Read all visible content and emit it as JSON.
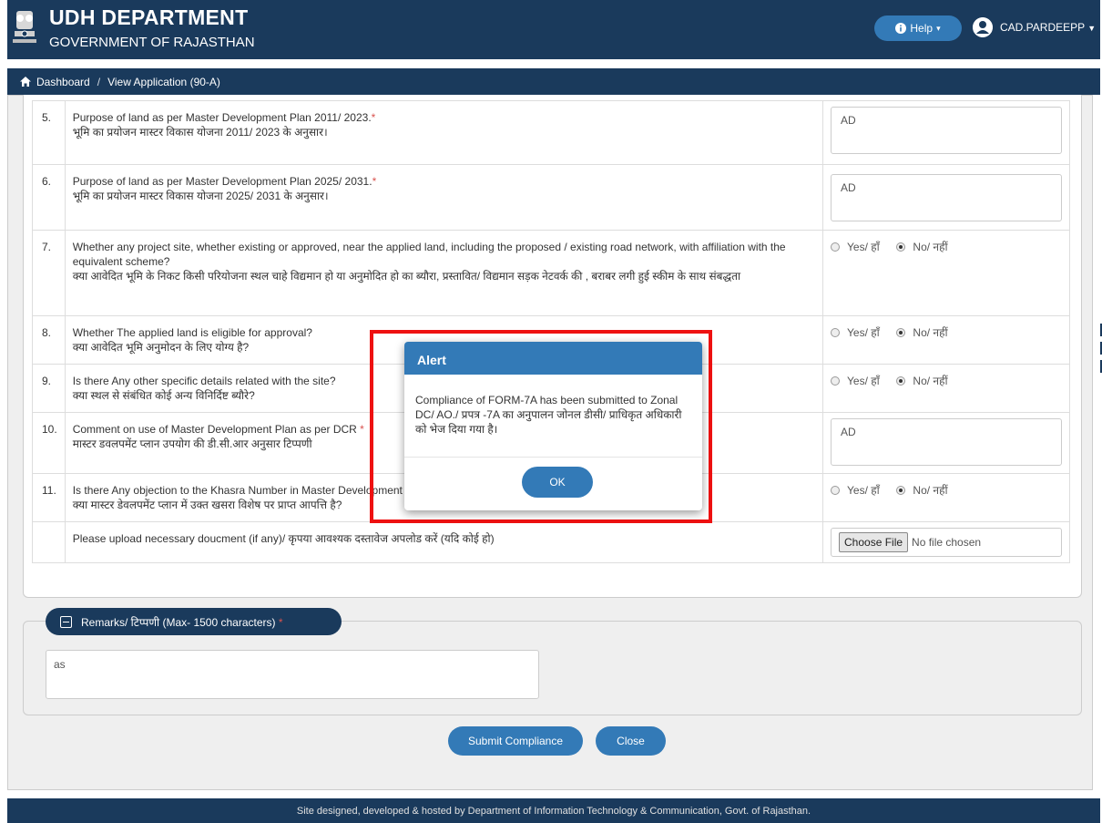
{
  "header": {
    "title": "UDH DEPARTMENT",
    "subtitle": "GOVERNMENT OF RAJASTHAN",
    "help_label": "Help",
    "user_name": "CAD.PARDEEPP",
    "colors": {
      "brand": "#1a3a5c",
      "accent": "#337ab7",
      "alert_frame": "#ee1111",
      "required": "#d9534f"
    }
  },
  "breadcrumb": {
    "home": "Dashboard",
    "separator": "/",
    "current": "View Application (90-A)"
  },
  "questions": [
    {
      "num": "5.",
      "en": "Purpose of land as per Master Development Plan 2011/ 2023.",
      "hi": "भूमि का प्रयोजन मास्टर विकास योजना 2011/ 2023 के अनुसार।",
      "required": "*",
      "answer_type": "text",
      "value": "AD"
    },
    {
      "num": "6.",
      "en": "Purpose of land as per Master Development Plan 2025/ 2031.",
      "hi": "भूमि का प्रयोजन मास्टर विकास योजना 2025/ 2031 के अनुसार।",
      "required": "*",
      "answer_type": "text",
      "value": "AD"
    },
    {
      "num": "7.",
      "en": "Whether any project site, whether existing or approved, near the applied land, including the proposed / existing road network, with affiliation with the equivalent scheme?",
      "hi": "क्या आवेदित भूमि के निकट किसी परियोजना स्थल चाहे विद्यमान हो या अनुमोदित हो का ब्यौरा, प्रस्तावित/ विद्यमान सड़क नेटवर्क की , बराबर लगी हुई स्कीम के साथ संबद्धता",
      "required": "",
      "answer_type": "radio",
      "selected": "no"
    },
    {
      "num": "8.",
      "en": "Whether The applied land is eligible for approval?",
      "hi": "क्या आवेदित भूमि अनुमोदन के लिए योग्य है?",
      "required": "",
      "answer_type": "radio",
      "selected": "no"
    },
    {
      "num": "9.",
      "en": "Is there Any other specific details related with the site?",
      "hi": "क्या स्थल से संबंधित कोई अन्य विनिर्दिष्ट ब्यौरे?",
      "required": "",
      "answer_type": "radio",
      "selected": "no"
    },
    {
      "num": "10.",
      "en": "Comment on use of Master Development Plan as per DCR",
      "hi": "मास्टर डवलपमेंट प्लान उपयोग की डी.सी.आर अनुसार टिप्पणी",
      "required": "*",
      "answer_type": "text",
      "value": "AD"
    },
    {
      "num": "11.",
      "en": "Is there Any objection to the Khasra Number in Master Development Plan?",
      "hi": "क्या मास्टर डेवलपमेंट प्लान में उक्त खसरा विशेष पर प्राप्त आपत्ति है?",
      "required": "",
      "answer_type": "radio",
      "selected": "no"
    }
  ],
  "radio_labels": {
    "yes": "Yes/ हाँ",
    "no": "No/ नहीं"
  },
  "upload": {
    "label": "Please upload necessary doucment (if any)/ कृपया आवश्यक दस्तावेज अपलोड करें (यदि कोई हो)",
    "button": "Choose File",
    "status": "No file chosen"
  },
  "remarks": {
    "legend": "Remarks/ टिप्पणी (Max- 1500 characters)",
    "required": "*",
    "value": "as"
  },
  "actions": {
    "submit": "Submit Compliance",
    "close": "Close"
  },
  "footer": {
    "text": "Site designed, developed & hosted by Department of Information Technology & Communication, Govt. of Rajasthan."
  },
  "alert": {
    "title": "Alert",
    "message": "Compliance of FORM-7A has been submitted to Zonal DC/ AO./ प्रपत्र -7A का अनुपालन जोनल डीसी/ प्राधिकृत अधिकारी को भेज दिया गया है।",
    "ok": "OK"
  }
}
